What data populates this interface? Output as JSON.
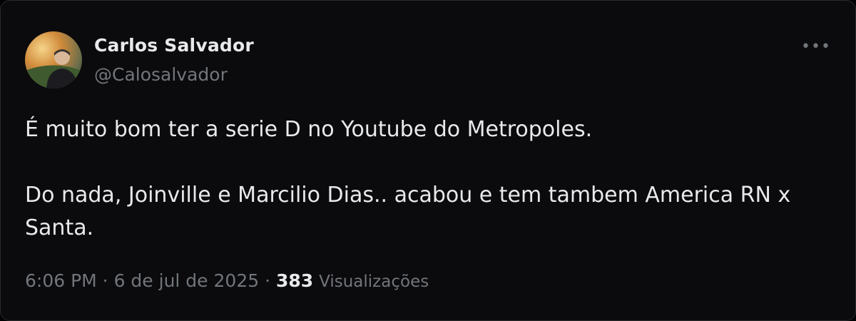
{
  "tweet": {
    "author_name": "Carlos Salvador",
    "author_handle": "@Calosalvador",
    "more_icon": "more-horizontal-icon",
    "text_line1": "É muito bom ter a serie D no Youtube do Metropoles.",
    "text_line2": "Do nada, Joinville e Marcilio Dias.. acabou e tem tambem America RN x",
    "text_line3": "Santa.",
    "time": "6:06 PM",
    "separator": " · ",
    "date": "6 de jul de 2025",
    "views_count": "383",
    "views_label": "Visualizações"
  },
  "colors": {
    "background": "#0b0a0d",
    "primary_text": "#e7e9ea",
    "secondary_text": "#71767b",
    "border": "#2a2a2e"
  }
}
